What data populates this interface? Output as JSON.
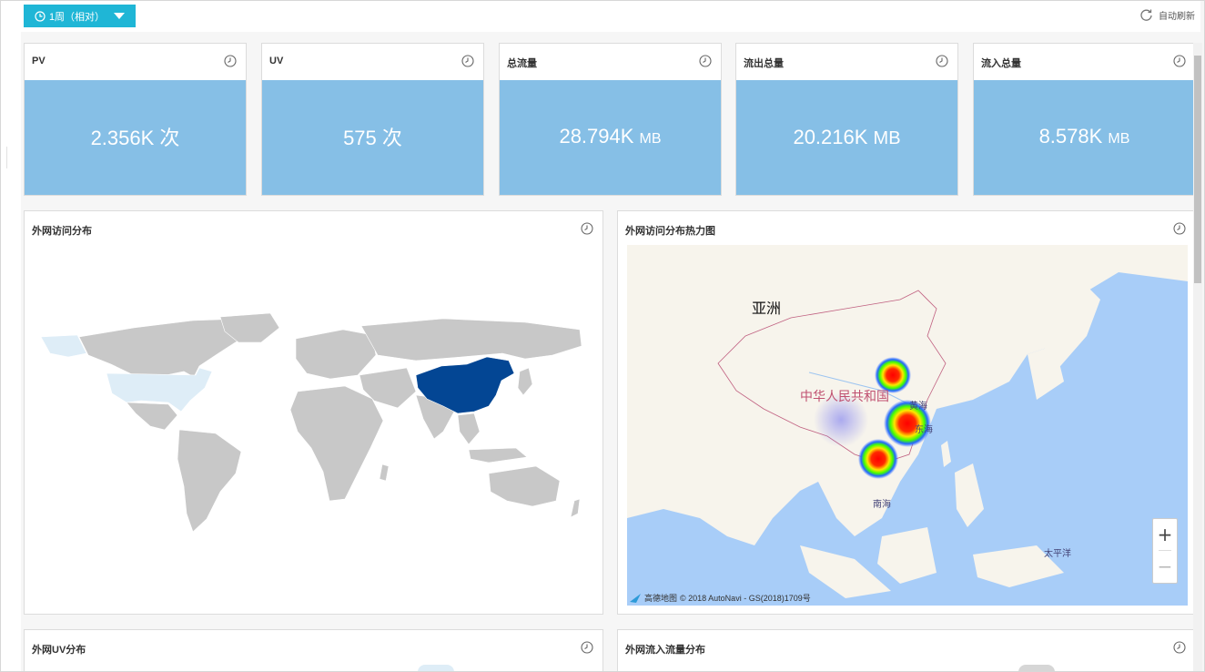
{
  "toolbar": {
    "time_range_label": "1周（相对）",
    "auto_refresh_label": "自动刷新"
  },
  "kpis": [
    {
      "title": "PV",
      "value": "2.356K",
      "unit": "次"
    },
    {
      "title": "UV",
      "value": "575",
      "unit": "次"
    },
    {
      "title": "总流量",
      "value": "28.794K",
      "unit": "MB"
    },
    {
      "title": "流出总量",
      "value": "20.216K",
      "unit": "MB"
    },
    {
      "title": "流入总量",
      "value": "8.578K",
      "unit": "MB"
    }
  ],
  "panels": {
    "world_map_title": "外网访问分布",
    "heatmap_title": "外网访问分布热力图",
    "uv_title": "外网UV分布",
    "inflow_title": "外网流入流量分布"
  },
  "heatmap": {
    "label_asia": "亚洲",
    "label_country": "中华人民共和国",
    "label_yellow_sea": "黄海",
    "label_east_sea": "东海",
    "label_south_sea": "南海",
    "label_pacific": "太平洋",
    "zoom_in": "+",
    "zoom_out": "−",
    "attribution_brand": "高德地图",
    "attribution_text": "© 2018 AutoNavi - GS(2018)1709号"
  },
  "colors": {
    "accent": "#1fb6d6",
    "kpi_fill": "#86bfe6",
    "map_highlight": "#034694",
    "map_secondary": "#deedf7",
    "map_land": "#c8c8c8",
    "ocean": "#a8cdf8"
  }
}
